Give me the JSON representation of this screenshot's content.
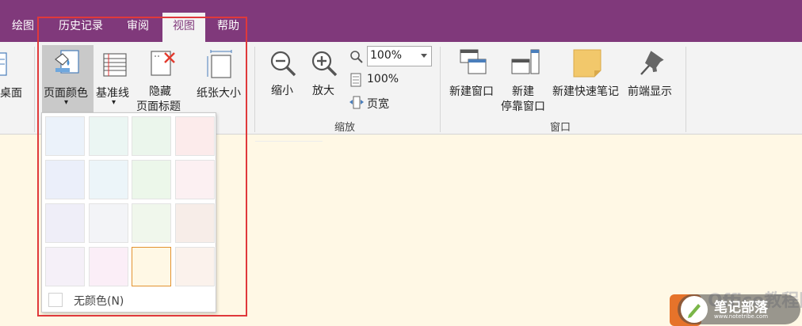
{
  "tabs": [
    {
      "label": "绘图",
      "active": false
    },
    {
      "label": "历史记录",
      "active": false
    },
    {
      "label": "审阅",
      "active": false
    },
    {
      "label": "视图",
      "active": true
    },
    {
      "label": "帮助",
      "active": false
    }
  ],
  "ribbon": {
    "desktop_label": "桌面",
    "page_color": {
      "label": "页面颜色",
      "arrow": "▾"
    },
    "rule_lines": {
      "label": "基准线",
      "arrow": "▾"
    },
    "hide_title": {
      "label_line1": "隐藏",
      "label_line2": "页面标题"
    },
    "paper_size": {
      "label": "纸张大小"
    },
    "zoom_out": {
      "label": "缩小"
    },
    "zoom_in": {
      "label": "放大"
    },
    "zoom_combo_value": "100%",
    "zoom_100": "100%",
    "page_width": "页宽",
    "zoom_group_label": "缩放",
    "new_window": {
      "label": "新建窗口"
    },
    "new_docked": {
      "label_line1": "新建",
      "label_line2": "停靠窗口"
    },
    "new_quick_note": {
      "label": "新建快速笔记"
    },
    "always_on_top": {
      "label": "前端显示"
    },
    "window_group_label": "窗口"
  },
  "color_panel": {
    "swatches": [
      [
        "#ebf2fa",
        "#ebf6f3",
        "#ebf6ec",
        "#fcebeb"
      ],
      [
        "#ebeffa",
        "#ecf5f9",
        "#ecf7ea",
        "#fcf0f2"
      ],
      [
        "#efeef8",
        "#f3f4f7",
        "#f0f7ec",
        "#f7ede8"
      ],
      [
        "#f5f0f8",
        "#fbeef7",
        "#fff8e5",
        "#fbf2ec"
      ]
    ],
    "selected": [
      3,
      2
    ],
    "no_color_label": "无颜色(N)"
  },
  "watermark": {
    "office_text": "Office教程网",
    "title": "笔记部落",
    "url": "www.notetribe.com"
  },
  "colors": {
    "tabbar": "#80397b",
    "ribbon": "#f3f3f3",
    "page_background": "#fff8e5",
    "annotation": "#e0393b",
    "selection": "#e3922f"
  }
}
